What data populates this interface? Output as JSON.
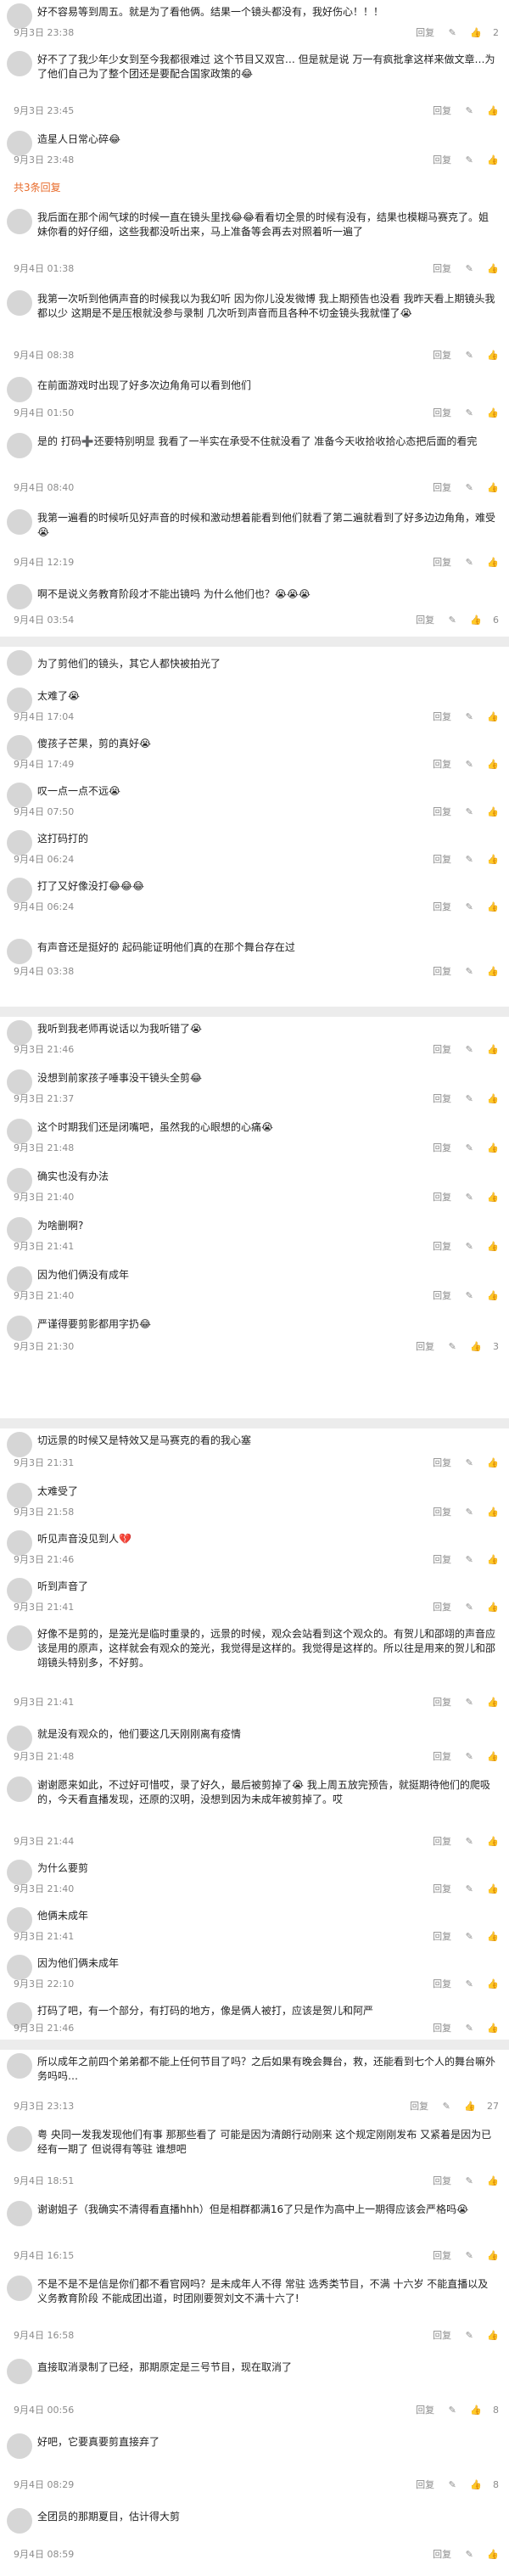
{
  "labels": {
    "reply": "回复",
    "like_icon": "thumb-up-icon",
    "reply_icon": "comment-icon"
  },
  "reply_count_text": "共3条回复",
  "comments": [
    {
      "text": "好不容易等到周五。就是为了看他俩。结果一个镜头都没有，我好伤心！！！",
      "time": "9月3日 23:38",
      "likes": "2"
    },
    {
      "text": "好不了了我少年少女到至今我都很难过 这个节目又双宫… 但是就是说 万一有疯批拿这样来做文章…为了他们自己为了整个团还是要配合国家政策的😂",
      "time": "9月3日 23:45",
      "likes": ""
    },
    {
      "text": "造星人日常心碎😂",
      "time": "9月3日 23:48",
      "likes": ""
    },
    {
      "text": "我后面在那个闹气球的时候一直在镜头里找😂😂看看切全景的时候有没有，结果也模糊马赛克了。姐妹你看的好仔细，这些我都没听出来，马上准备等会再去对照着听一遍了",
      "time": "9月4日 01:38",
      "likes": ""
    },
    {
      "text": "我第一次听到他俩声音的时候我以为我幻听 因为你儿没发微博 我上期预告也没看 我昨天看上期镜头我都以少 这期是不是压根就没参与录制 几次听到声音而且各种不切金镜头我就懂了😭",
      "time": "9月4日 08:38",
      "likes": ""
    },
    {
      "text": "在前面游戏时出现了好多次边角角可以看到他们",
      "time": "9月4日 01:50",
      "likes": ""
    },
    {
      "text": "是的 打码➕还要特别明显 我看了一半实在承受不住就没看了 准备今天收拾收拾心态把后面的看完",
      "time": "9月4日 08:40",
      "likes": ""
    },
    {
      "text": "我第一遍看的时候听见好声音的时候和激动想着能看到他们就看了第二遍就看到了好多边边角角，难受😭",
      "time": "9月4日 12:19",
      "likes": ""
    },
    {
      "text": "啊不是说义务教育阶段才不能出镜吗 为什么他们也？😭😭😭",
      "time": "9月4日 03:54",
      "likes": "6"
    },
    {
      "text": "为了剪他们的镜头，其它人都快被拍光了",
      "time": "",
      "likes": ""
    },
    {
      "text": "太难了😭",
      "time": "9月4日 17:04",
      "likes": ""
    },
    {
      "text": "傻孩子芒果，剪的真好😭",
      "time": "9月4日 17:49",
      "likes": ""
    },
    {
      "text": "叹一点一点不远😭",
      "time": "9月4日 07:50",
      "likes": ""
    },
    {
      "text": "这打码打的",
      "time": "9月4日 06:24",
      "likes": ""
    },
    {
      "text": "打了又好像没打😂😂😂",
      "time": "9月4日 06:24",
      "likes": ""
    },
    {
      "text": "有声音还是挺好的 起码能证明他们真的在那个舞台存在过",
      "time": "9月4日 03:38",
      "likes": ""
    },
    {
      "text": "我听到我老师再说话以为我听错了😭",
      "time": "9月3日 21:46",
      "likes": ""
    },
    {
      "text": "没想到前家孩子唾事没干镜头全剪😂",
      "time": "9月3日 21:37",
      "likes": ""
    },
    {
      "text": "这个时期我们还是闭嘴吧，虽然我的心眼想的心痛😭",
      "time": "9月3日 21:48",
      "likes": ""
    },
    {
      "text": "确实也没有办法",
      "time": "9月3日 21:40",
      "likes": ""
    },
    {
      "text": "为啥删啊?",
      "time": "9月3日 21:41",
      "likes": ""
    },
    {
      "text": "因为他们俩没有成年",
      "time": "9月3日 21:40",
      "likes": ""
    },
    {
      "text": "严谨得要剪影都用字扔😂",
      "time": "9月3日 21:30",
      "likes": "3"
    },
    {
      "text": "切远景的时候又是特效又是马赛克的看的我心塞",
      "time": "9月3日 21:31",
      "likes": ""
    },
    {
      "text": "太难受了",
      "time": "9月3日 21:58",
      "likes": ""
    },
    {
      "text": "听见声音没见到人💔",
      "time": "9月3日 21:46",
      "likes": ""
    },
    {
      "text": "听到声音了",
      "time": "9月3日 21:41",
      "likes": ""
    },
    {
      "text": "好像不是剪的，是笼光是临时重录的，远景的时候，观众会站看到这个观众的。有贺儿和邵翊的声音应该是用的原声，这样就会有观众的笼光，我觉得是这样的。我觉得是这样的。所以往是用来的贺儿和邵翊镜头特别多，不好剪。",
      "time": "9月3日 21:41",
      "likes": ""
    },
    {
      "text": "就是没有观众的，他们要这几天刚刚离有疫情",
      "time": "9月3日 21:48",
      "likes": ""
    },
    {
      "text": "谢谢愿来如此，不过好可惜哎，录了好久，最后被剪掉了😭 我上周五放完预告，就挺期待他们的爬吸的，今天看直播发现，还原的汉明，没想到因为未成年被剪掉了。哎",
      "time": "9月3日 21:44",
      "likes": ""
    },
    {
      "text": "为什么要剪",
      "time": "9月3日 21:40",
      "likes": ""
    },
    {
      "text": "他俩未成年",
      "time": "9月3日 21:41",
      "likes": ""
    },
    {
      "text": "因为他们俩未成年",
      "time": "9月3日 22:10",
      "likes": ""
    },
    {
      "text": "打码了吧，有一个部分，有打码的地方，像是俩人被打，应该是贺儿和阿严",
      "time": "9月3日 21:46",
      "likes": ""
    },
    {
      "text": "所以成年之前四个弟弟都不能上任何节目了吗？之后如果有晚会舞台，救，还能看到七个人的舞台嘛外务吗吗…",
      "time": "9月3日 23:13",
      "likes": "27"
    },
    {
      "text": "粤 央同一发我发现他们有事 那那些看了 可能是因为清朗行动刚来 这个规定刚刚发布 又紧着是因为已经有一期了 但说得有等驻 谁想吧",
      "time": "9月4日 18:51",
      "likes": ""
    },
    {
      "text": "谢谢姐子（我确实不清得看直播hhh）但是相群都满16了只是作为高中上一期得应该会严格吗😭",
      "time": "9月4日 16:15",
      "likes": ""
    },
    {
      "text": "不是不是不是信是你们都不看官网吗？是未成年人不得 常驻 选秀类节目，不满 十六岁 不能直播以及 义务教育阶段 不能成团出道，时团刚要贺刘文不满十六了!",
      "time": "9月4日 16:58",
      "likes": ""
    },
    {
      "text": "直接取消录制了已经，那期原定是三号节目，现在取消了",
      "time": "9月4日 00:56",
      "likes": "8"
    },
    {
      "text": "好吧，它要真要剪直接弃了",
      "time": "9月4日 08:29",
      "likes": "8"
    },
    {
      "text": "全团员的那期夏目，估计得大剪",
      "time": "9月4日 08:59",
      "likes": ""
    }
  ]
}
